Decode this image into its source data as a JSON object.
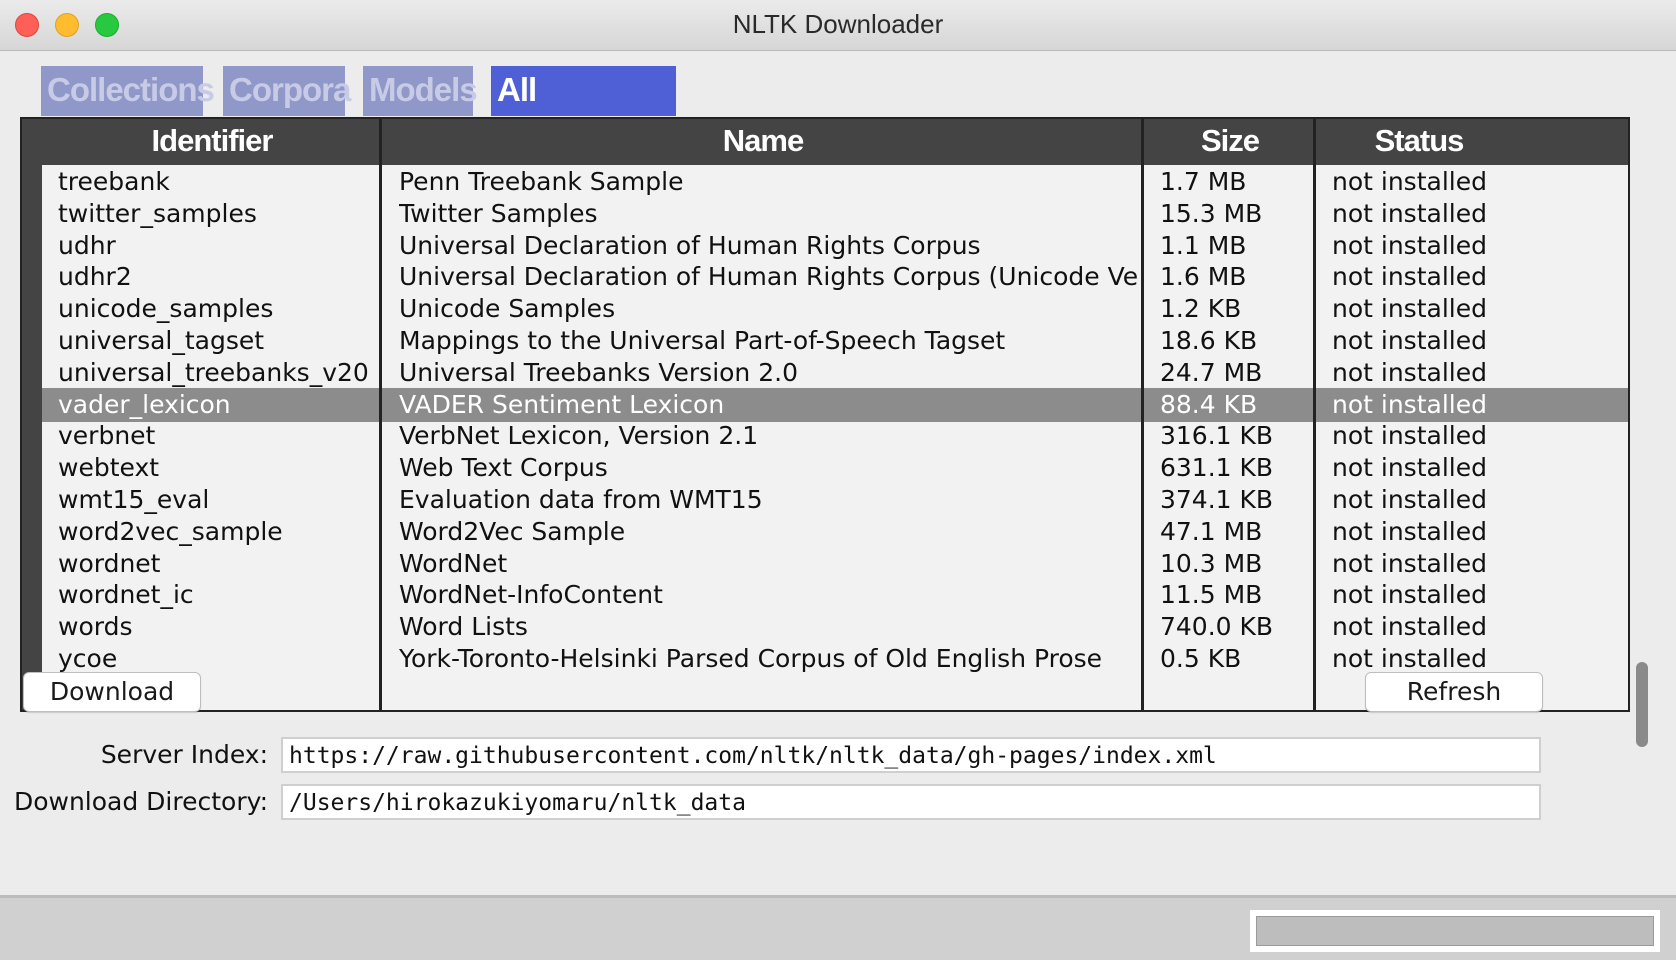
{
  "window": {
    "title": "NLTK Downloader"
  },
  "tabs": [
    {
      "label": "Collections",
      "active": false
    },
    {
      "label": "Corpora",
      "active": false
    },
    {
      "label": "Models",
      "active": false
    },
    {
      "label": "All Packages",
      "active": true
    }
  ],
  "table": {
    "headers": {
      "identifier": "Identifier",
      "name": "Name",
      "size": "Size",
      "status": "Status"
    },
    "rows": [
      {
        "identifier": "treebank",
        "name": "Penn Treebank Sample",
        "size": "1.7 MB",
        "status": "not installed"
      },
      {
        "identifier": "twitter_samples",
        "name": "Twitter Samples",
        "size": "15.3 MB",
        "status": "not installed"
      },
      {
        "identifier": "udhr",
        "name": "Universal Declaration of Human Rights Corpus",
        "size": "1.1 MB",
        "status": "not installed"
      },
      {
        "identifier": "udhr2",
        "name": "Universal Declaration of Human Rights Corpus (Unicode Versi",
        "size": "1.6 MB",
        "status": "not installed"
      },
      {
        "identifier": "unicode_samples",
        "name": "Unicode Samples",
        "size": "1.2 KB",
        "status": "not installed"
      },
      {
        "identifier": "universal_tagset",
        "name": "Mappings to the Universal Part-of-Speech Tagset",
        "size": "18.6 KB",
        "status": "not installed"
      },
      {
        "identifier": "universal_treebanks_v20",
        "name": "Universal Treebanks Version 2.0",
        "size": "24.7 MB",
        "status": "not installed"
      },
      {
        "identifier": "vader_lexicon",
        "name": "VADER Sentiment Lexicon",
        "size": "88.4 KB",
        "status": "not installed",
        "selected": true
      },
      {
        "identifier": "verbnet",
        "name": "VerbNet Lexicon, Version 2.1",
        "size": "316.1 KB",
        "status": "not installed"
      },
      {
        "identifier": "webtext",
        "name": "Web Text Corpus",
        "size": "631.1 KB",
        "status": "not installed"
      },
      {
        "identifier": "wmt15_eval",
        "name": "Evaluation data from WMT15",
        "size": "374.1 KB",
        "status": "not installed"
      },
      {
        "identifier": "word2vec_sample",
        "name": "Word2Vec Sample",
        "size": "47.1 MB",
        "status": "not installed"
      },
      {
        "identifier": "wordnet",
        "name": "WordNet",
        "size": "10.3 MB",
        "status": "not installed"
      },
      {
        "identifier": "wordnet_ic",
        "name": "WordNet-InfoContent",
        "size": "11.5 MB",
        "status": "not installed"
      },
      {
        "identifier": "words",
        "name": "Word Lists",
        "size": "740.0 KB",
        "status": "not installed"
      },
      {
        "identifier": "ycoe",
        "name": "York-Toronto-Helsinki Parsed Corpus of Old English Prose",
        "size": "0.5 KB",
        "status": "not installed"
      }
    ]
  },
  "buttons": {
    "download": "Download",
    "refresh": "Refresh"
  },
  "form": {
    "server_index_label": "Server Index:",
    "server_index_value": "https://raw.githubusercontent.com/nltk/nltk_data/gh-pages/index.xml",
    "download_dir_label": "Download Directory:",
    "download_dir_value": "/Users/hirokazukiyomaru/nltk_data"
  },
  "colors": {
    "tab_active": "#4f5fd6",
    "tab_inactive": "#8f98c9",
    "header_bg": "#444444",
    "selected_row": "#8c8c8c"
  }
}
